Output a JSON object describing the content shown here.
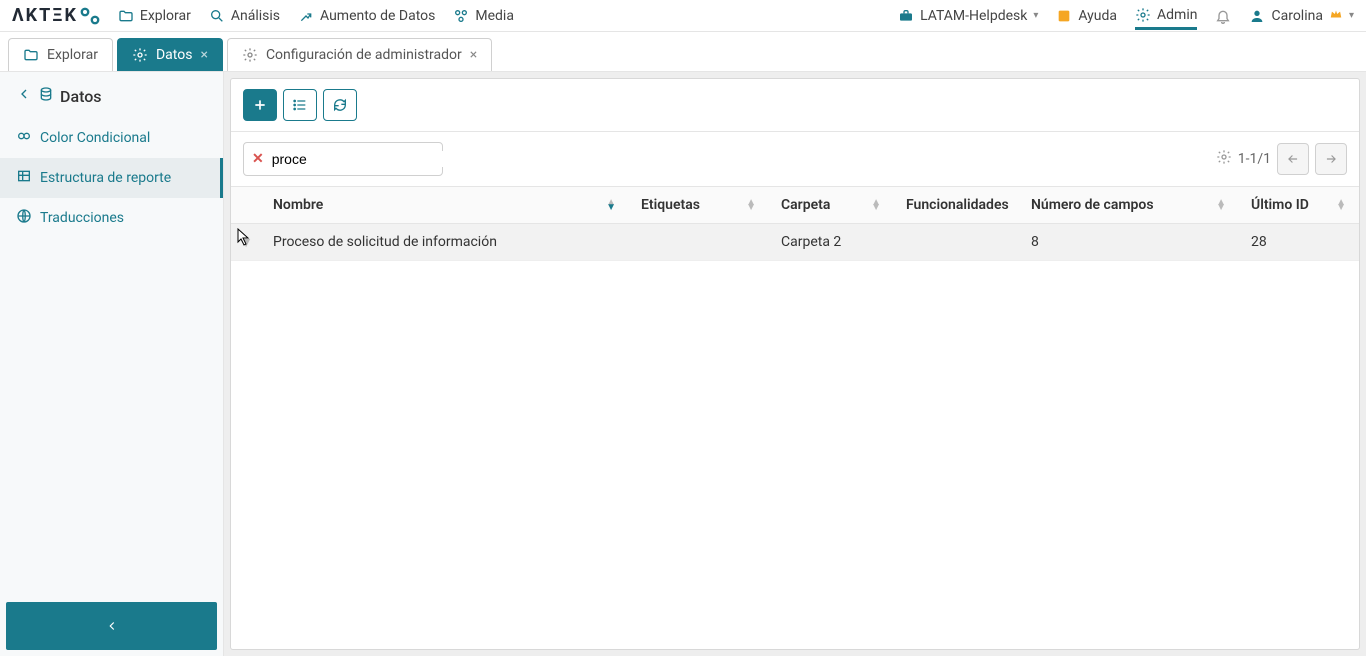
{
  "topnav": {
    "items": [
      {
        "label": "Explorar"
      },
      {
        "label": "Análisis"
      },
      {
        "label": "Aumento de Datos"
      },
      {
        "label": "Media"
      }
    ]
  },
  "topnav_right": {
    "workspace": "LATAM-Helpdesk",
    "help": "Ayuda",
    "admin": "Admin",
    "user": "Carolina"
  },
  "tabs": [
    {
      "label": "Explorar",
      "closable": false,
      "active": false
    },
    {
      "label": "Datos",
      "closable": true,
      "active": true
    },
    {
      "label": "Configuración de administrador",
      "closable": true,
      "active": false
    }
  ],
  "sidebar": {
    "title": "Datos",
    "items": [
      {
        "label": "Color Condicional",
        "selected": false
      },
      {
        "label": "Estructura de reporte",
        "selected": true
      },
      {
        "label": "Traducciones",
        "selected": false
      }
    ]
  },
  "search": {
    "value": "proce"
  },
  "pager": {
    "text": "1-1/1"
  },
  "table": {
    "headers": {
      "nombre": "Nombre",
      "etiquetas": "Etiquetas",
      "carpeta": "Carpeta",
      "funcionalidades": "Funcionalidades",
      "numero_campos": "Número de campos",
      "ultimo_id": "Último ID"
    },
    "rows": [
      {
        "nombre": "Proceso de solicitud de información",
        "etiquetas": "",
        "carpeta": "Carpeta 2",
        "funcionalidades": "",
        "numero_campos": "8",
        "ultimo_id": "28"
      }
    ]
  }
}
